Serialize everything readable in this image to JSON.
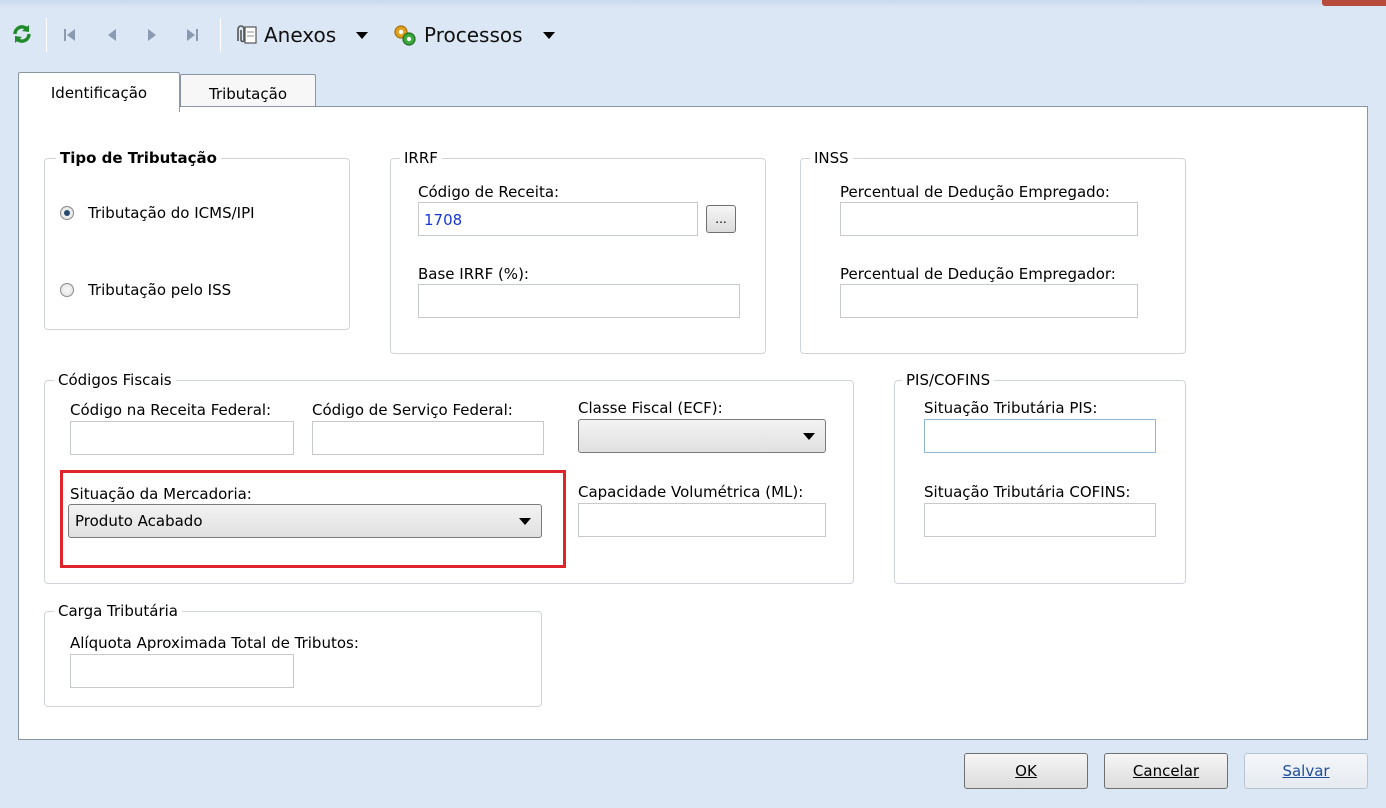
{
  "toolbar": {
    "refresh_icon": "refresh-icon",
    "nav_first": "first-record-icon",
    "nav_prev": "previous-record-icon",
    "nav_next": "next-record-icon",
    "nav_last": "last-record-icon",
    "attachments_label": "Anexos",
    "processes_label": "Processos"
  },
  "tabs": [
    {
      "label": "Identificação",
      "active": true
    },
    {
      "label": "Tributação",
      "active": false
    }
  ],
  "tipo_tributacao": {
    "legend": "Tipo de Tributação",
    "options": [
      {
        "label": "Tributação do ICMS/IPI",
        "selected": true
      },
      {
        "label": "Tributação pelo ISS",
        "selected": false
      }
    ]
  },
  "irrf": {
    "legend": "IRRF",
    "codigo_receita_label": "Código de Receita:",
    "codigo_receita_value": "1708",
    "browse_label": "...",
    "base_label": "Base IRRF (%):",
    "base_value": ""
  },
  "inss": {
    "legend": "INSS",
    "empregado_label": "Percentual de Dedução Empregado:",
    "empregado_value": "",
    "empregador_label": "Percentual de Dedução Empregador:",
    "empregador_value": ""
  },
  "codigos_fiscais": {
    "legend": "Códigos Fiscais",
    "receita_federal_label": "Código na Receita Federal:",
    "servico_federal_label": "Código de Serviço Federal:",
    "classe_fiscal_label": "Classe Fiscal (ECF):",
    "classe_fiscal_value": "",
    "situacao_label": "Situação da Mercadoria:",
    "situacao_value": "Produto Acabado",
    "capacidade_label": "Capacidade Volumétrica (ML):"
  },
  "pis_cofins": {
    "legend": "PIS/COFINS",
    "pis_label": "Situação Tributária PIS:",
    "cofins_label": "Situação Tributária COFINS:"
  },
  "carga_tributaria": {
    "legend": "Carga Tributária",
    "aliquota_label": "Alíquota Aproximada Total de Tributos:"
  },
  "footer": {
    "ok_label": "OK",
    "cancel_label": "Cancelar",
    "save_label": "Salvar"
  },
  "colors": {
    "highlight_box": "#e0242c",
    "window_bg": "#dbe7f5",
    "value_text": "#1a37d6"
  }
}
